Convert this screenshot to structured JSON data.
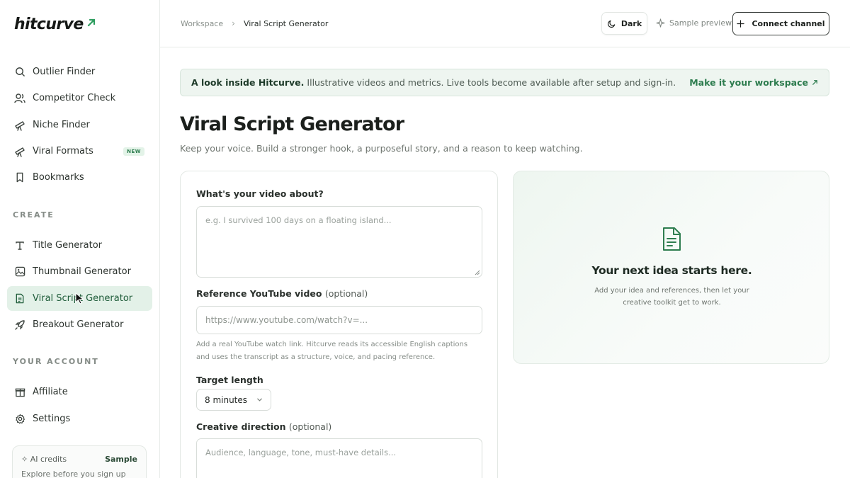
{
  "app": {
    "logo": "hitcurve",
    "brand_color": "#2e7d4f"
  },
  "sidebar": {
    "items": [
      {
        "label": "Outlier Finder",
        "icon": "search-icon"
      },
      {
        "label": "Competitor Check",
        "icon": "users-icon"
      },
      {
        "label": "Niche Finder",
        "icon": "telescope-icon"
      },
      {
        "label": "Viral Formats",
        "icon": "telescope-icon",
        "badge": "NEW"
      },
      {
        "label": "Bookmarks",
        "icon": "bookmark-icon"
      }
    ],
    "create_label": "CREATE",
    "create_items": [
      {
        "label": "Title Generator",
        "icon": "type-icon"
      },
      {
        "label": "Thumbnail Generator",
        "icon": "image-icon"
      },
      {
        "label": "Viral Script Generator",
        "icon": "file-text-icon",
        "active": true
      },
      {
        "label": "Breakout Generator",
        "icon": "rocket-icon"
      }
    ],
    "account_label": "YOUR ACCOUNT",
    "account_items": [
      {
        "label": "Affiliate",
        "icon": "gift-icon"
      },
      {
        "label": "Settings",
        "icon": "gear-icon"
      }
    ],
    "credits": {
      "title": "✧ AI credits",
      "sample": "Sample",
      "subtitle": "Explore before you sign up"
    }
  },
  "header": {
    "breadcrumb": [
      "Workspace",
      "Viral Script Generator"
    ],
    "dark_label": "Dark",
    "sample_preview": "Sample preview",
    "connect_label": "Connect channel"
  },
  "banner": {
    "strong": "A look inside Hitcurve.",
    "text": "Illustrative videos and metrics. Live tools become available after setup and sign-in.",
    "link": "Make it your workspace"
  },
  "main": {
    "title": "Viral Script Generator",
    "subtitle": "Keep your voice. Build a stronger hook, a purposeful story, and a reason to keep watching."
  },
  "form": {
    "about_label": "What's your video about?",
    "about_placeholder": "e.g. I survived 100 days on a floating island...",
    "reference_label": "Reference YouTube video",
    "reference_optional": "(optional)",
    "reference_placeholder": "https://www.youtube.com/watch?v=...",
    "reference_help": "Add a real YouTube watch link. Hitcurve reads its accessible English captions and uses the transcript as a structure, voice, and pacing reference.",
    "length_label": "Target length",
    "length_value": "8 minutes",
    "direction_label": "Creative direction",
    "direction_optional": "(optional)",
    "direction_placeholder": "Audience, language, tone, must-have details..."
  },
  "preview": {
    "icon": "document-icon",
    "title": "Your next idea starts here.",
    "text": "Add your idea and references, then let your creative toolkit get to work."
  }
}
